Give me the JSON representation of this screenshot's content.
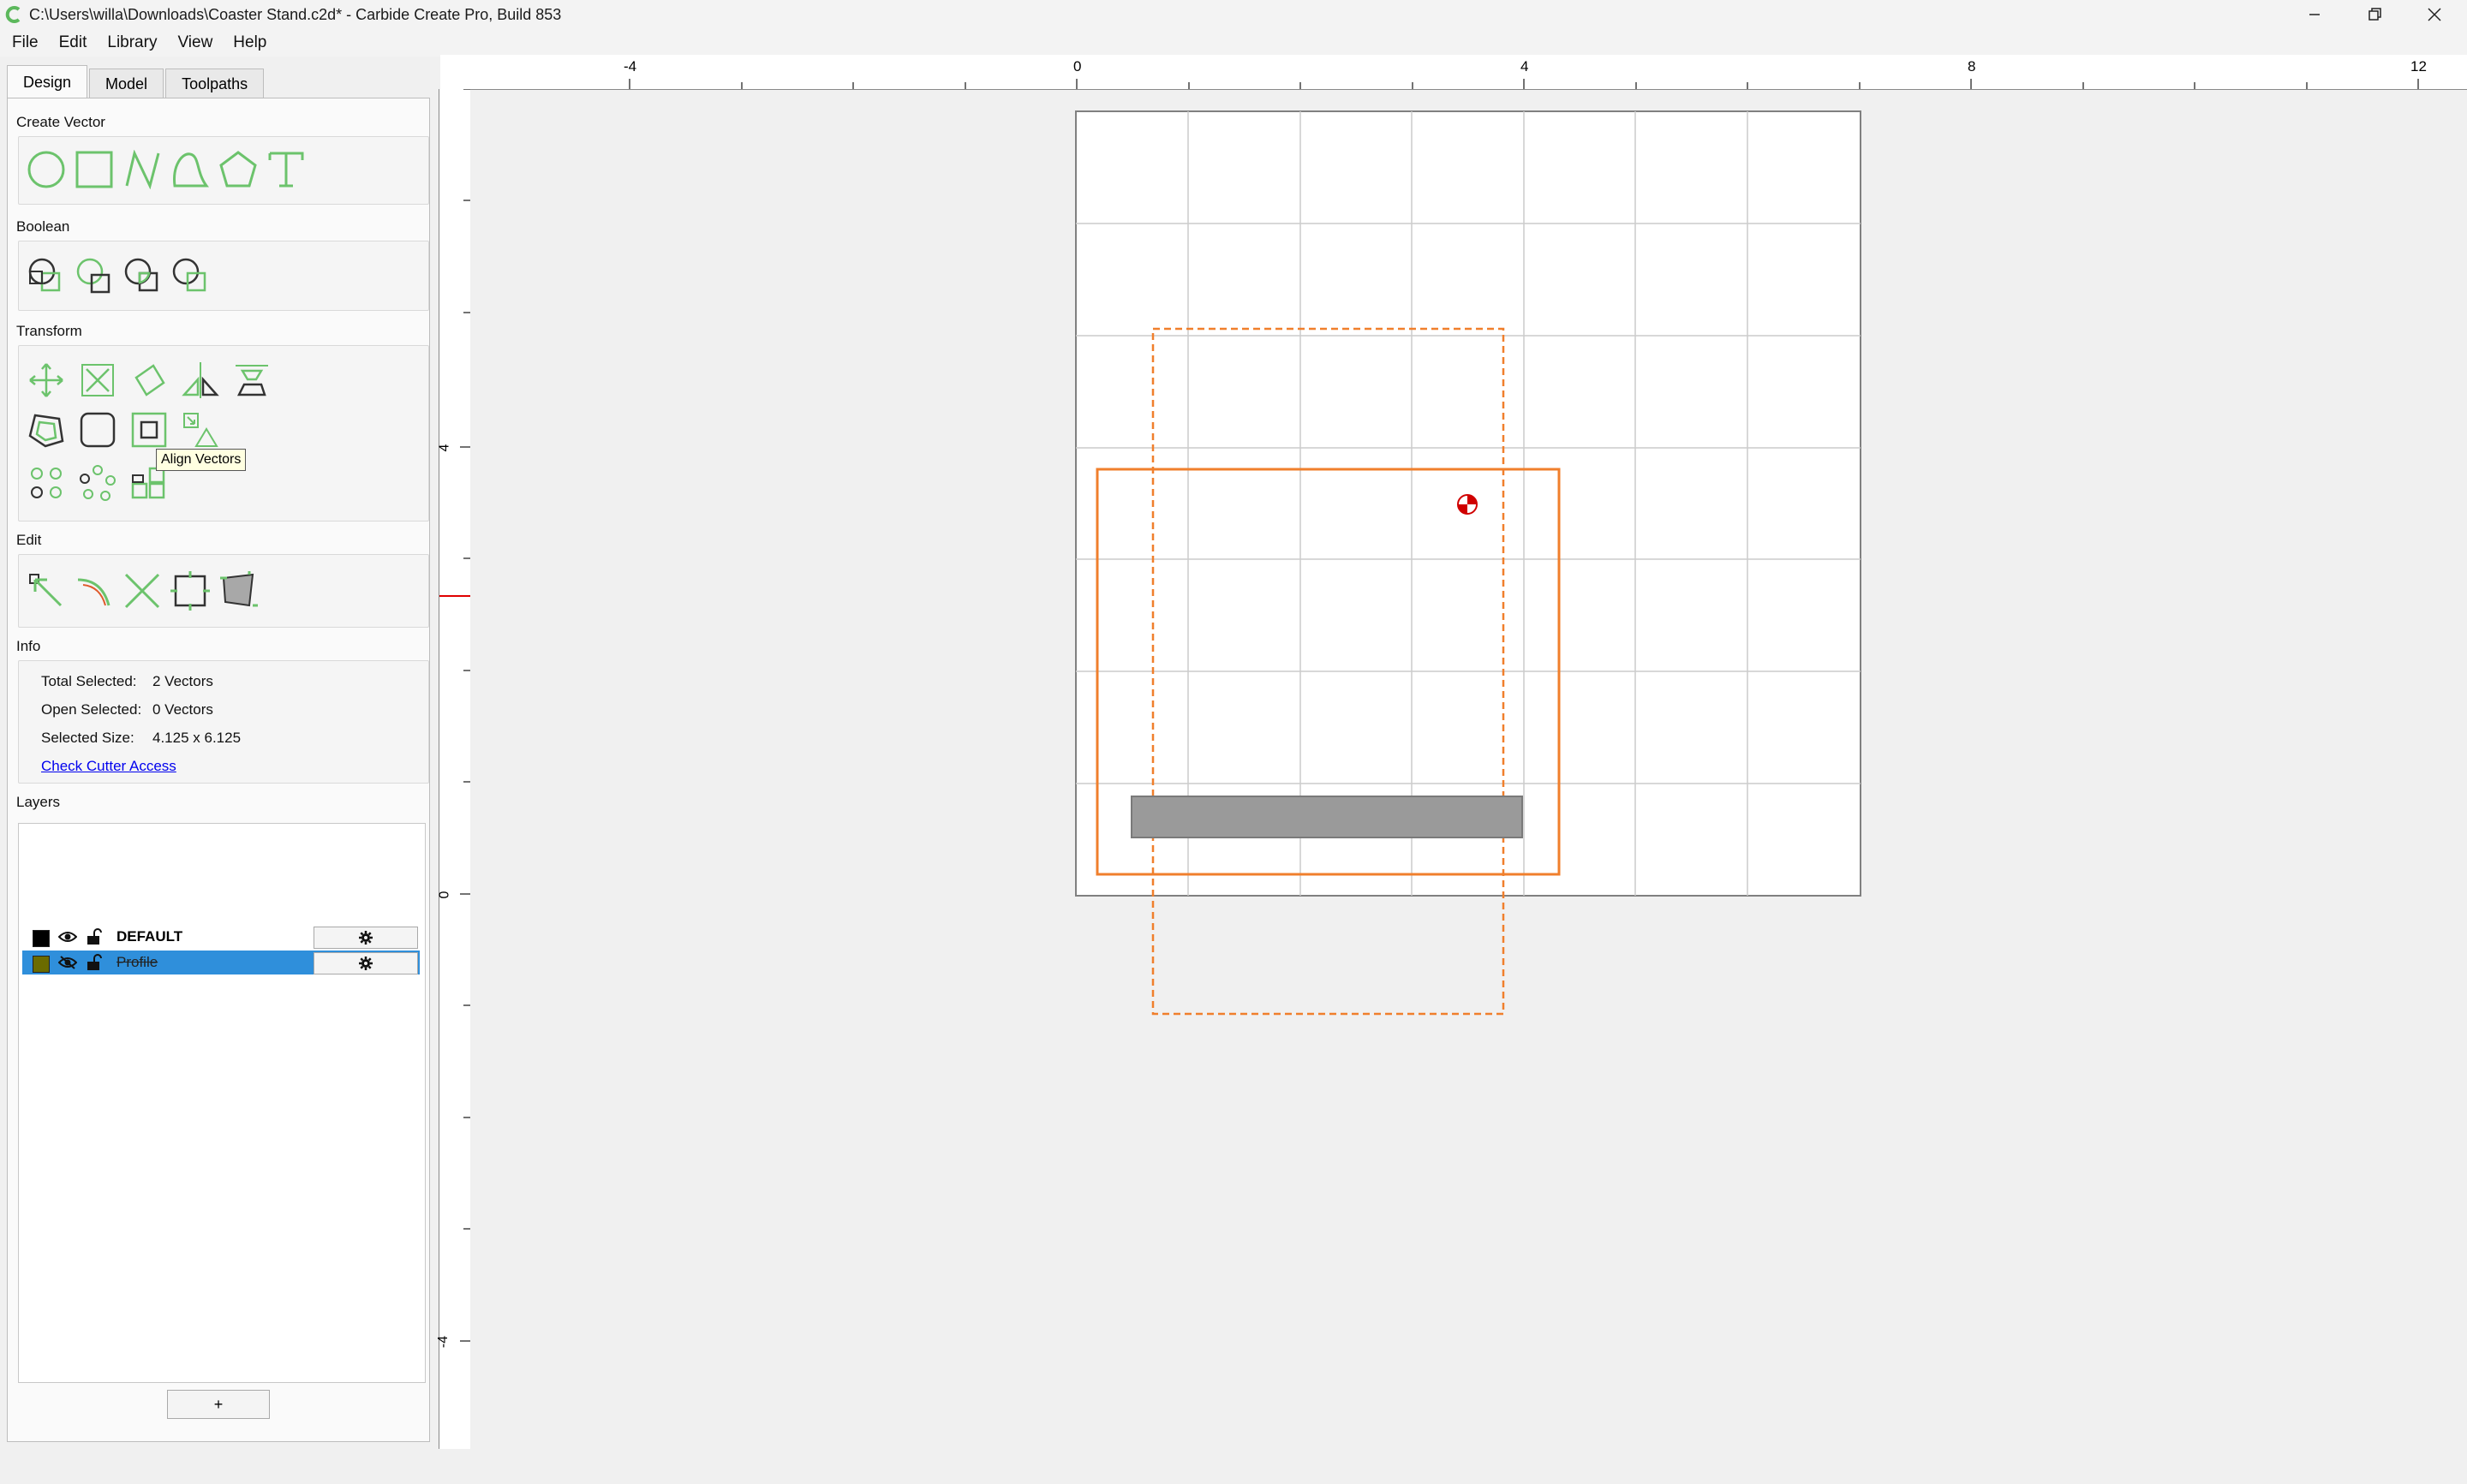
{
  "window": {
    "title": "C:\\Users\\willa\\Downloads\\Coaster Stand.c2d* - Carbide Create Pro, Build 853",
    "controls": [
      "minimize-icon",
      "restore-icon",
      "close-icon"
    ]
  },
  "menu": [
    "File",
    "Edit",
    "Library",
    "View",
    "Help"
  ],
  "tabs": [
    "Design",
    "Model",
    "Toolpaths"
  ],
  "sections": {
    "create_vector": "Create Vector",
    "boolean": "Boolean",
    "transform": "Transform",
    "edit": "Edit",
    "info": "Info",
    "layers": "Layers"
  },
  "create_vector_icons": [
    "circle-icon",
    "rectangle-icon",
    "polyline-icon",
    "curve-icon",
    "polygon-icon",
    "text-icon"
  ],
  "boolean_icons": [
    "union-icon",
    "subtract-icon",
    "intersect-icon",
    "split-icon"
  ],
  "transform_icons": [
    "move-icon",
    "scale-icon",
    "rotate-icon",
    "mirror-icon",
    "trim-icon",
    "offset-icon",
    "fillet-icon",
    "align-vectors-icon",
    "nest-icon",
    "circular-array-icon",
    "pattern-array-icon",
    "rectangular-array-icon"
  ],
  "edit_icons": [
    "node-edit-icon",
    "smooth-icon",
    "cut-path-icon",
    "join-icon",
    "close-vector-icon"
  ],
  "tooltip": "Align Vectors",
  "info": {
    "total_selected_label": "Total Selected:",
    "total_selected_value": "2 Vectors",
    "open_selected_label": "Open Selected:",
    "open_selected_value": "0 Vectors",
    "selected_size_label": "Selected Size:",
    "selected_size_value": "4.125 x 6.125",
    "check_cutter_access": "Check Cutter Access"
  },
  "layers": [
    {
      "name": "DEFAULT",
      "color": "#000000",
      "visible": true,
      "locked": false,
      "selected": false
    },
    {
      "name": "Profile",
      "color": "#6b6b00",
      "visible": false,
      "locked": false,
      "selected": true
    }
  ],
  "add_layer_label": "+",
  "ruler_top_labels": [
    "-4",
    "0",
    "4",
    "8",
    "12"
  ],
  "ruler_left_labels": [
    "4",
    "0",
    "-4"
  ],
  "colors": {
    "accent_green": "#5cb85c",
    "selection_orange": "#f07f2c",
    "layer_selected": "#2f8fdb",
    "grid_line": "#cccccc",
    "stock_border": "#808080"
  }
}
